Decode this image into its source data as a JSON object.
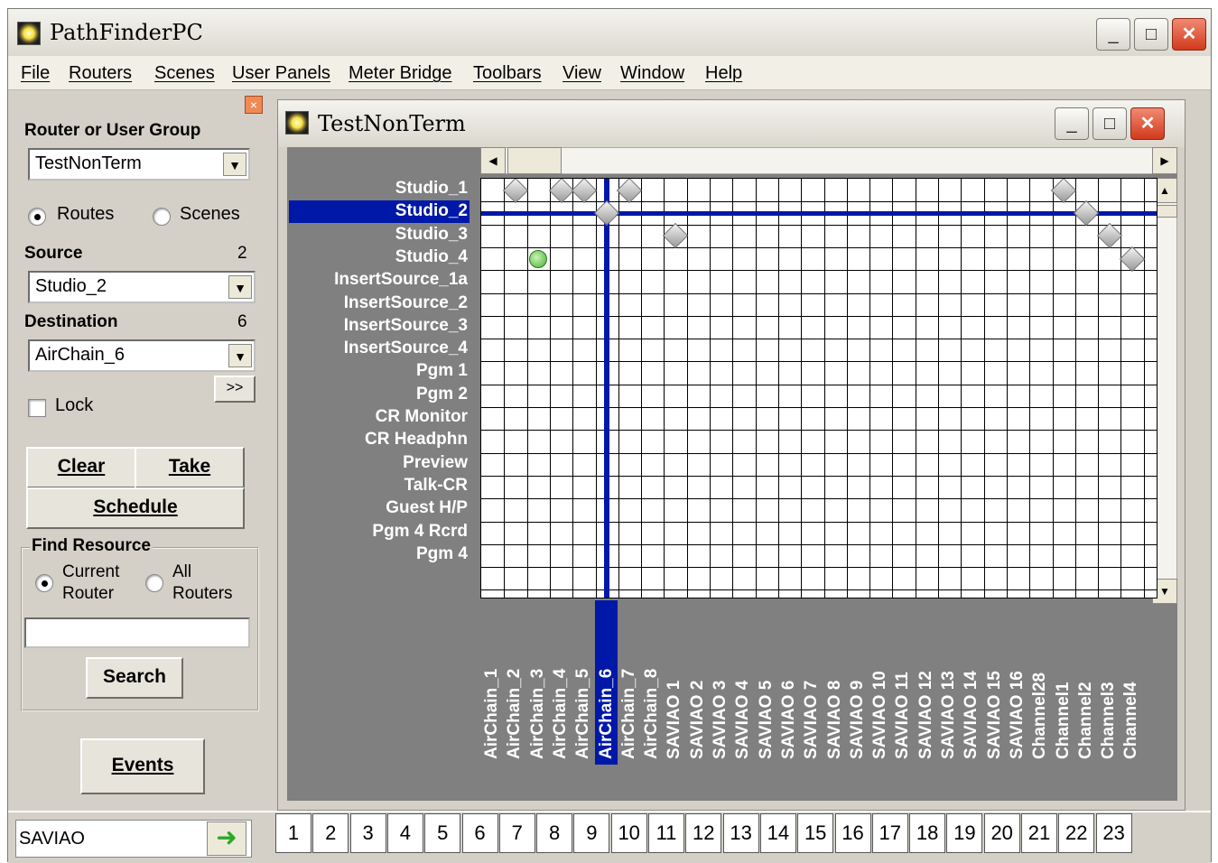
{
  "app": {
    "title": "PathFinderPC",
    "min": "_",
    "max": "□",
    "close": "✕"
  },
  "menu": [
    "File",
    "Routers",
    "Scenes",
    "User Panels",
    "Meter Bridge",
    "Toolbars",
    "View",
    "Window",
    "Help"
  ],
  "panel": {
    "group_label": "Router or User Group",
    "group_value": "TestNonTerm",
    "mode_routes": "Routes",
    "mode_scenes": "Scenes",
    "source_label": "Source",
    "source_num": "2",
    "source_value": "Studio_2",
    "dest_label": "Destination",
    "dest_num": "6",
    "dest_value": "AirChain_6",
    "more": ">>",
    "lock": "Lock",
    "clear": "Clear",
    "take": "Take",
    "schedule": "Schedule",
    "find_title": "Find Resource",
    "current_router_1": "Current",
    "current_router_2": "Router",
    "all_routers_1": "All",
    "all_routers_2": "Routers",
    "search_value": "",
    "search": "Search",
    "events": "Events",
    "dock_close": "×"
  },
  "matrix": {
    "title": "TestNonTerm",
    "rows": [
      "Studio_1",
      "Studio_2",
      "Studio_3",
      "Studio_4",
      "InsertSource_1a",
      "InsertSource_2",
      "InsertSource_3",
      "InsertSource_4",
      "Pgm 1",
      "Pgm 2",
      "CR Monitor",
      "CR Headphn",
      "Preview",
      "Talk-CR",
      "Guest H/P",
      "Pgm 4 Rcrd",
      "Pgm 4"
    ],
    "cols": [
      "AirChain_1",
      "AirChain_2",
      "AirChain_3",
      "AirChain_4",
      "AirChain_5",
      "AirChain_6",
      "AirChain_7",
      "AirChain_8",
      "SAVIAO 1",
      "SAVIAO 2",
      "SAVIAO 3",
      "SAVIAO 4",
      "SAVIAO 5",
      "SAVIAO 6",
      "SAVIAO 7",
      "SAVIAO 8",
      "SAVIAO 9",
      "SAVIAO 10",
      "SAVIAO 11",
      "SAVIAO 12",
      "SAVIAO 13",
      "SAVIAO 14",
      "SAVIAO 15",
      "SAVIAO 16",
      "Channel28",
      "Channel1",
      "Channel2",
      "Channel3",
      "Channel4"
    ],
    "selected_row": 1,
    "selected_col": 5,
    "crosspoints": [
      {
        "row": 0,
        "col": 1,
        "state": "gray"
      },
      {
        "row": 0,
        "col": 3,
        "state": "gray"
      },
      {
        "row": 0,
        "col": 4,
        "state": "gray"
      },
      {
        "row": 0,
        "col": 6,
        "state": "gray"
      },
      {
        "row": 0,
        "col": 25,
        "state": "gray"
      },
      {
        "row": 1,
        "col": 5,
        "state": "gray"
      },
      {
        "row": 1,
        "col": 26,
        "state": "gray"
      },
      {
        "row": 2,
        "col": 8,
        "state": "gray"
      },
      {
        "row": 2,
        "col": 27,
        "state": "gray"
      },
      {
        "row": 3,
        "col": 2,
        "state": "green"
      },
      {
        "row": 3,
        "col": 28,
        "state": "gray"
      }
    ],
    "colors": {
      "selection": "#0018a8",
      "background": "#808080"
    }
  },
  "status": {
    "text": "SAVIAO",
    "tabs": [
      "1",
      "2",
      "3",
      "4",
      "5",
      "6",
      "7",
      "8",
      "9",
      "10",
      "11",
      "12",
      "13",
      "14",
      "15",
      "16",
      "17",
      "18",
      "19",
      "20",
      "21",
      "22",
      "23"
    ]
  }
}
